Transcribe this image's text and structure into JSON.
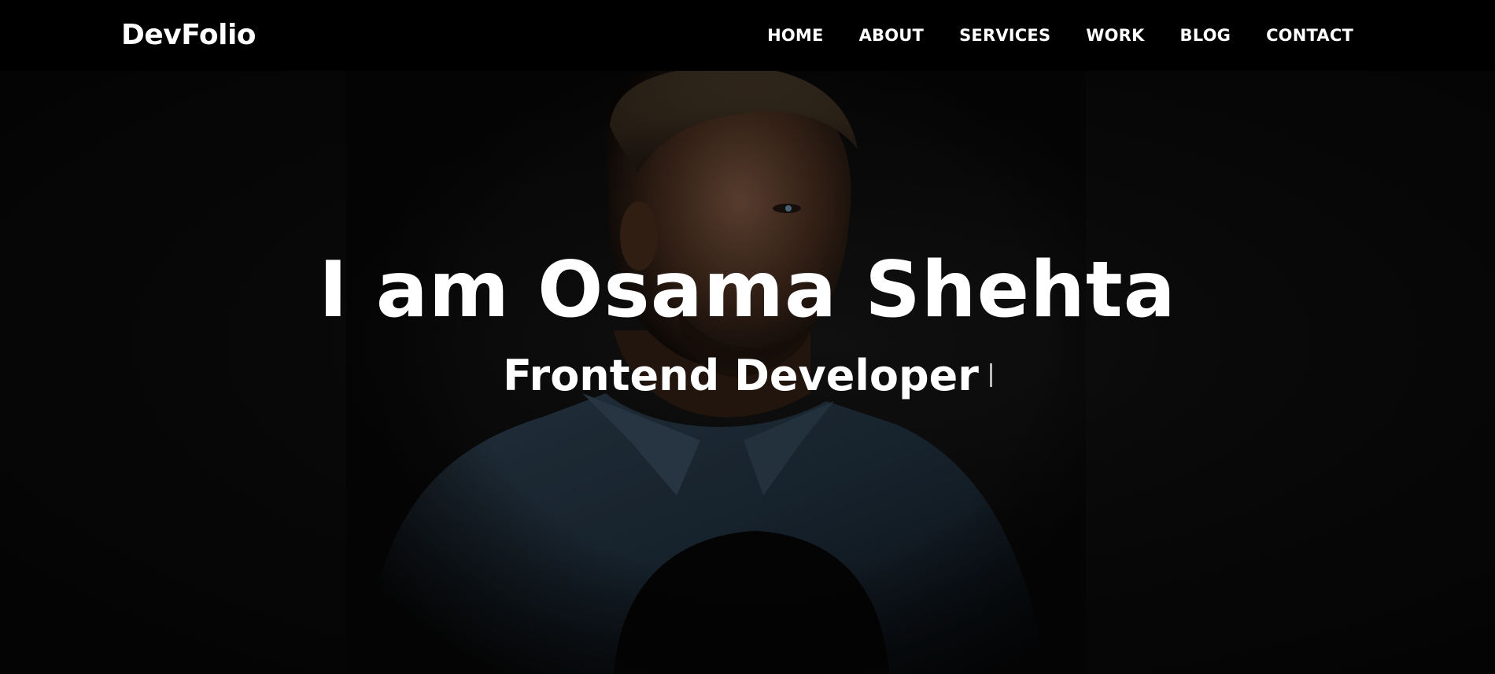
{
  "header": {
    "brand": "DevFolio",
    "nav": [
      "HOME",
      "ABOUT",
      "SERVICES",
      "WORK",
      "BLOG",
      "CONTACT"
    ]
  },
  "hero": {
    "title": "I am Osama Shehta",
    "subtitle": "Frontend Developer"
  },
  "colors": {
    "header_bg": "#000000",
    "text": "#ffffff",
    "hero_bg": "#070707"
  }
}
